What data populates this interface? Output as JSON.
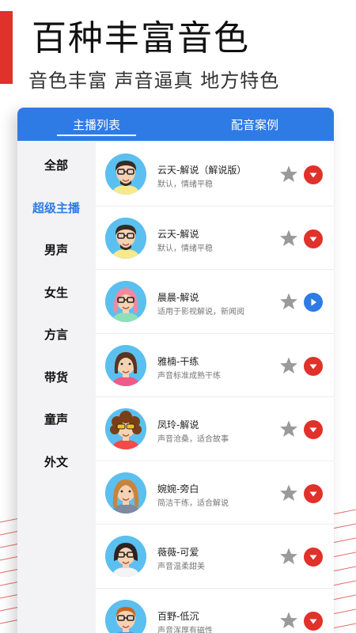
{
  "headline": "百种丰富音色",
  "subline": "音色丰富 声音逼真 地方特色",
  "tabs": [
    {
      "label": "主播列表",
      "active": true
    },
    {
      "label": "配音案例",
      "active": false
    }
  ],
  "sidebar": {
    "active": "超级主播",
    "items": [
      {
        "label": "全部"
      },
      {
        "label": "超级主播"
      },
      {
        "label": "男声"
      },
      {
        "label": "女生"
      },
      {
        "label": "方言"
      },
      {
        "label": "带货"
      },
      {
        "label": "童声"
      },
      {
        "label": "外文"
      }
    ]
  },
  "colors": {
    "accent": "#2f7be6",
    "brand_red": "#e0312a",
    "star_gray": "#9a9a9a"
  },
  "voices": [
    {
      "name": "云天-解说（解说版）",
      "desc": "默认，情绪平稳",
      "avatar": "male-glasses",
      "action": "download-icon",
      "action_color": "red"
    },
    {
      "name": "云天-解说",
      "desc": "默认，情绪平稳",
      "avatar": "male-glasses",
      "action": "download-icon",
      "action_color": "red"
    },
    {
      "name": "晨晨-解说",
      "desc": "适用于影视解说，新闻阅",
      "avatar": "female-pink-hair",
      "action": "play-icon",
      "action_color": "blue"
    },
    {
      "name": "雅楠-干练",
      "desc": "声音标准成熟干练",
      "avatar": "female-brown-hair",
      "action": "download-icon",
      "action_color": "red"
    },
    {
      "name": "凤玲-解说",
      "desc": "声音沧桑，适合故事",
      "avatar": "female-curly-sunglasses",
      "action": "download-icon",
      "action_color": "red"
    },
    {
      "name": "婉婉-旁白",
      "desc": "简洁干练，适合解说",
      "avatar": "female-long-hair",
      "action": "download-icon",
      "action_color": "red"
    },
    {
      "name": "薇薇-可爱",
      "desc": "声音温柔甜美",
      "avatar": "female-bob-glasses",
      "action": "download-icon",
      "action_color": "red"
    },
    {
      "name": "百野-低沉",
      "desc": "声音浑厚有磁性",
      "avatar": "male-ginger-glasses",
      "action": "download-icon",
      "action_color": "red"
    }
  ]
}
